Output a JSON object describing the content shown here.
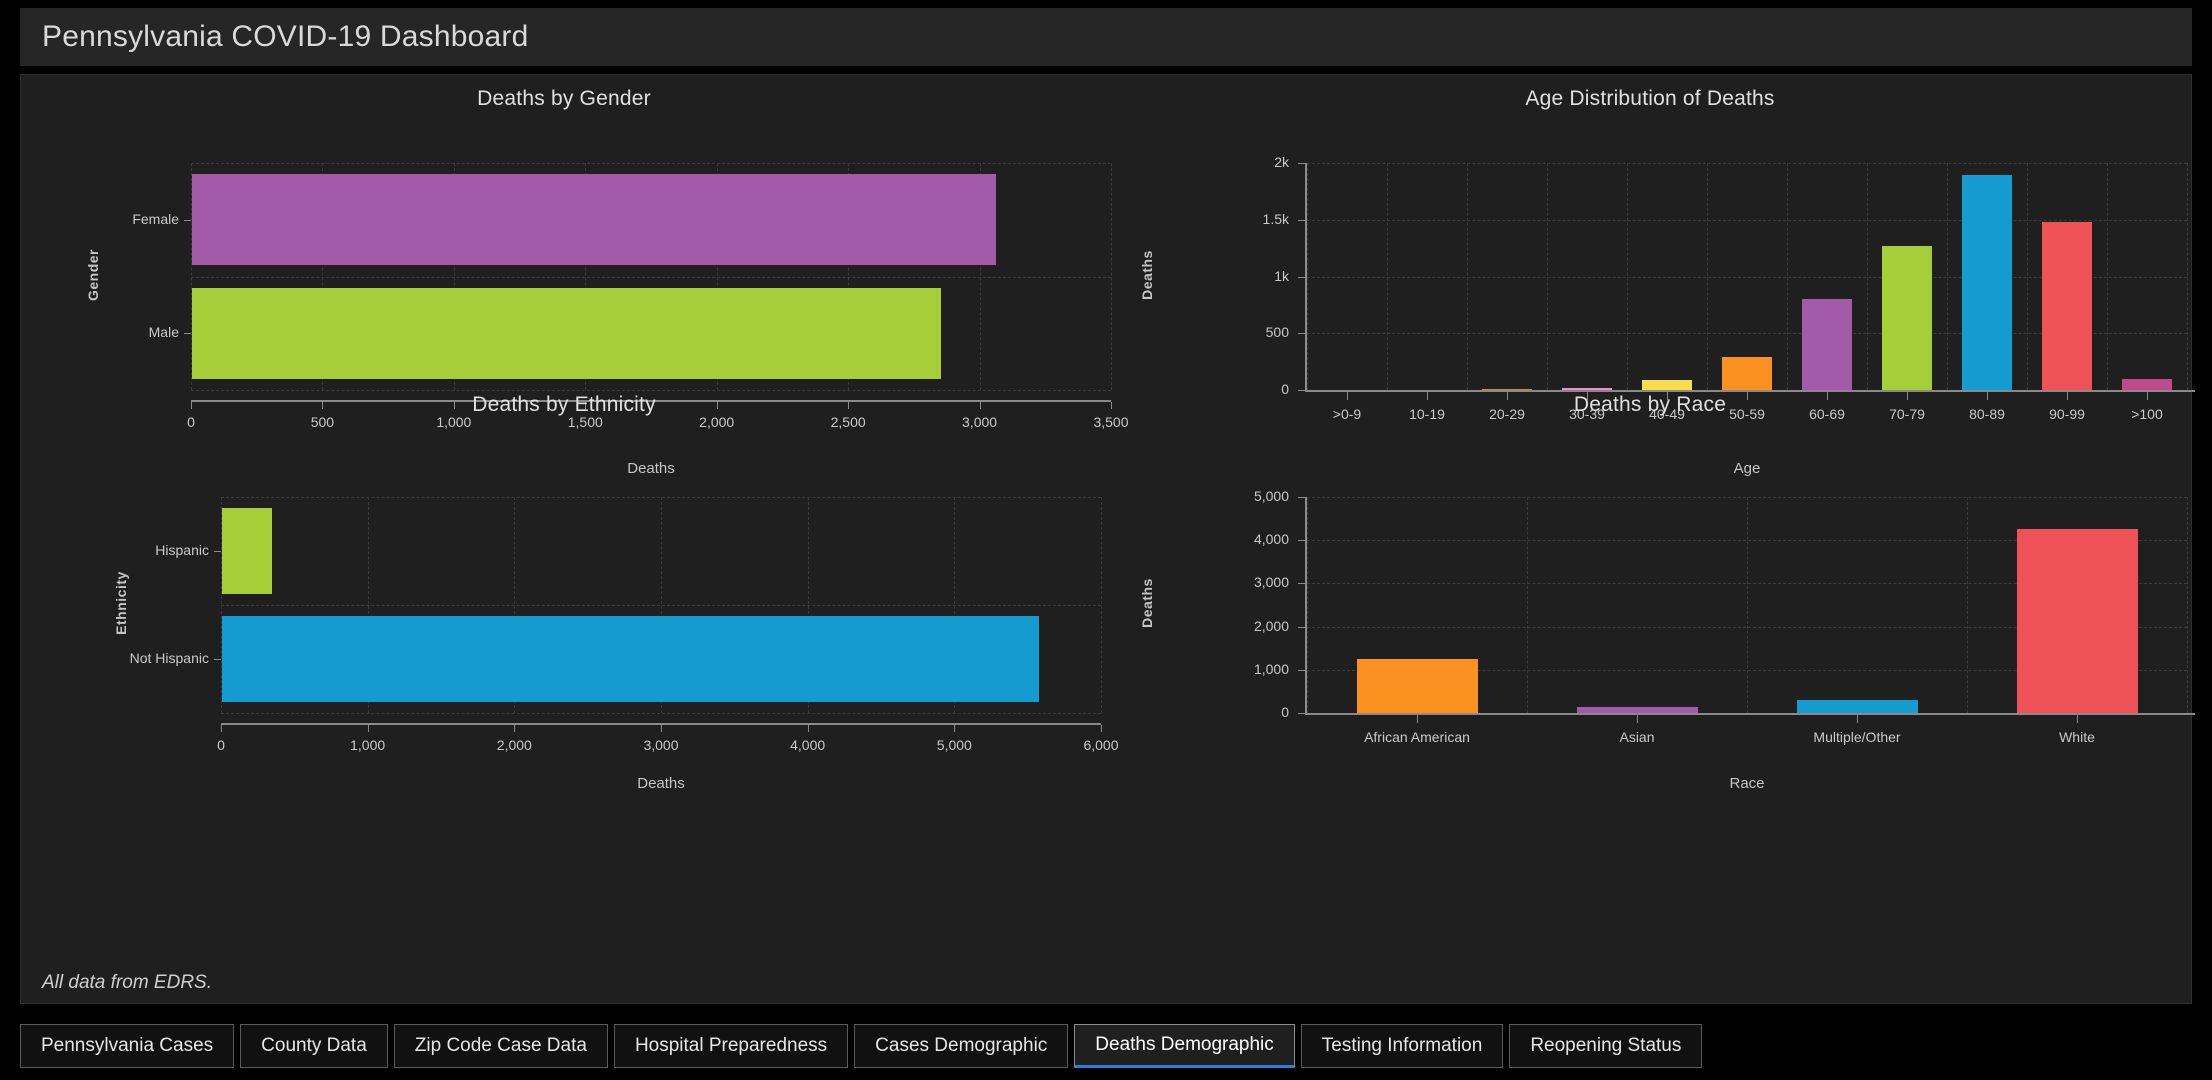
{
  "header": {
    "title": "Pennsylvania COVID-19 Dashboard"
  },
  "footer": {
    "note": "All data from EDRS."
  },
  "tabs": {
    "items": [
      {
        "label": "Pennsylvania Cases",
        "active": false
      },
      {
        "label": "County Data",
        "active": false
      },
      {
        "label": "Zip Code Case Data",
        "active": false
      },
      {
        "label": "Hospital Preparedness",
        "active": false
      },
      {
        "label": "Cases Demographic",
        "active": false
      },
      {
        "label": "Deaths Demographic",
        "active": true
      },
      {
        "label": "Testing Information",
        "active": false
      },
      {
        "label": "Reopening Status",
        "active": false
      }
    ],
    "active_accent": "#2a7fd4"
  },
  "chart_data": [
    {
      "id": "deaths-by-gender",
      "type": "bar",
      "orientation": "horizontal",
      "title": "Deaths by Gender",
      "xlabel": "Deaths",
      "ylabel": "Gender",
      "categories": [
        "Female",
        "Male"
      ],
      "values": [
        3060,
        2850
      ],
      "colors": [
        "#a35aa8",
        "#a6ce39"
      ],
      "xlim": [
        0,
        3500
      ],
      "xticks": [
        0,
        500,
        1000,
        1500,
        2000,
        2500,
        3000,
        3500
      ],
      "xticklabels": [
        "0",
        "500",
        "1,000",
        "1,500",
        "2,000",
        "2,500",
        "3,000",
        "3,500"
      ],
      "grid": true,
      "legend": "none"
    },
    {
      "id": "age-distribution-of-deaths",
      "type": "bar",
      "orientation": "vertical",
      "title": "Age Distribution of Deaths",
      "xlabel": "Age",
      "ylabel": "Deaths",
      "categories": [
        ">0-9",
        "10-19",
        "20-29",
        "30-39",
        "40-49",
        "50-59",
        "60-69",
        "70-79",
        "80-89",
        "90-99",
        ">100"
      ],
      "values": [
        0,
        0,
        10,
        22,
        88,
        292,
        800,
        1270,
        1890,
        1480,
        97
      ],
      "colors": [
        "#e05c4e",
        "#6fbf6a",
        "#c98c3c",
        "#ef8ecb",
        "#f9dd4f",
        "#fb9120",
        "#a35aa8",
        "#a6ce39",
        "#149bd0",
        "#ee5256",
        "#c04a8a"
      ],
      "ylim": [
        0,
        2000
      ],
      "yticks": [
        0,
        500,
        1000,
        1500,
        2000
      ],
      "yticklabels": [
        "0",
        "500",
        "1k",
        "1.5k",
        "2k"
      ],
      "grid": true,
      "legend": "none"
    },
    {
      "id": "deaths-by-ethnicity",
      "type": "bar",
      "orientation": "horizontal",
      "title": "Deaths by Ethnicity",
      "xlabel": "Deaths",
      "ylabel": "Ethnicity",
      "categories": [
        "Hispanic",
        "Not Hispanic"
      ],
      "values": [
        340,
        5570
      ],
      "colors": [
        "#a6ce39",
        "#149bd0"
      ],
      "xlim": [
        0,
        6000
      ],
      "xticks": [
        0,
        1000,
        2000,
        3000,
        4000,
        5000,
        6000
      ],
      "xticklabels": [
        "0",
        "1,000",
        "2,000",
        "3,000",
        "4,000",
        "5,000",
        "6,000"
      ],
      "grid": true,
      "legend": "none"
    },
    {
      "id": "deaths-by-race",
      "type": "bar",
      "orientation": "vertical",
      "title": "Deaths by Race",
      "xlabel": "Race",
      "ylabel": "Deaths",
      "categories": [
        "African American",
        "Asian",
        "Multiple/Other",
        "White"
      ],
      "values": [
        1250,
        150,
        300,
        4250
      ],
      "colors": [
        "#fb9120",
        "#a35aa8",
        "#149bd0",
        "#ee5256"
      ],
      "ylim": [
        0,
        5000
      ],
      "yticks": [
        0,
        1000,
        2000,
        3000,
        4000,
        5000
      ],
      "yticklabels": [
        "0",
        "1,000",
        "2,000",
        "3,000",
        "4,000",
        "5,000"
      ],
      "grid": true,
      "legend": "none"
    }
  ]
}
